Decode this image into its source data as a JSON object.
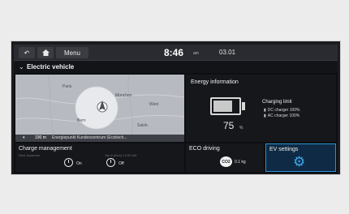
{
  "topbar": {
    "back_icon": "back-arrow-icon",
    "home_icon": "home-icon",
    "menu_label": "Menu",
    "time": "8:46",
    "ampm": "am",
    "date": "03.01"
  },
  "section": {
    "icon": "chevron-down-icon",
    "title": "Electric vehicle"
  },
  "map": {
    "cities": [
      "Paris",
      "München",
      "Wien",
      "Bern",
      "Salzb."
    ],
    "distance": "190 m",
    "place": "Energiepunkt Kundenzentrum (Erzbisch..."
  },
  "energy": {
    "title": "Energy information",
    "battery_percent": 75,
    "percent_value": "75",
    "percent_unit": "%",
    "limit_title": "Charging limit",
    "dc_limit": "DC charger 100%",
    "ac_limit": "AC charger 100%"
  },
  "charge": {
    "title": "Charge management",
    "sub1": "Next departure",
    "sub2": "Jan 8 (Mon) 12:00 AM",
    "state1": "On",
    "state2": "Off"
  },
  "eco": {
    "title": "ECO driving",
    "co2_label": "CO2",
    "value": "0.1 kg"
  },
  "ev": {
    "title": "EV settings",
    "icon": "gear-icon"
  },
  "colors": {
    "accent": "#2b93d6",
    "panel": "#16171b",
    "background": "#0d0e11"
  }
}
